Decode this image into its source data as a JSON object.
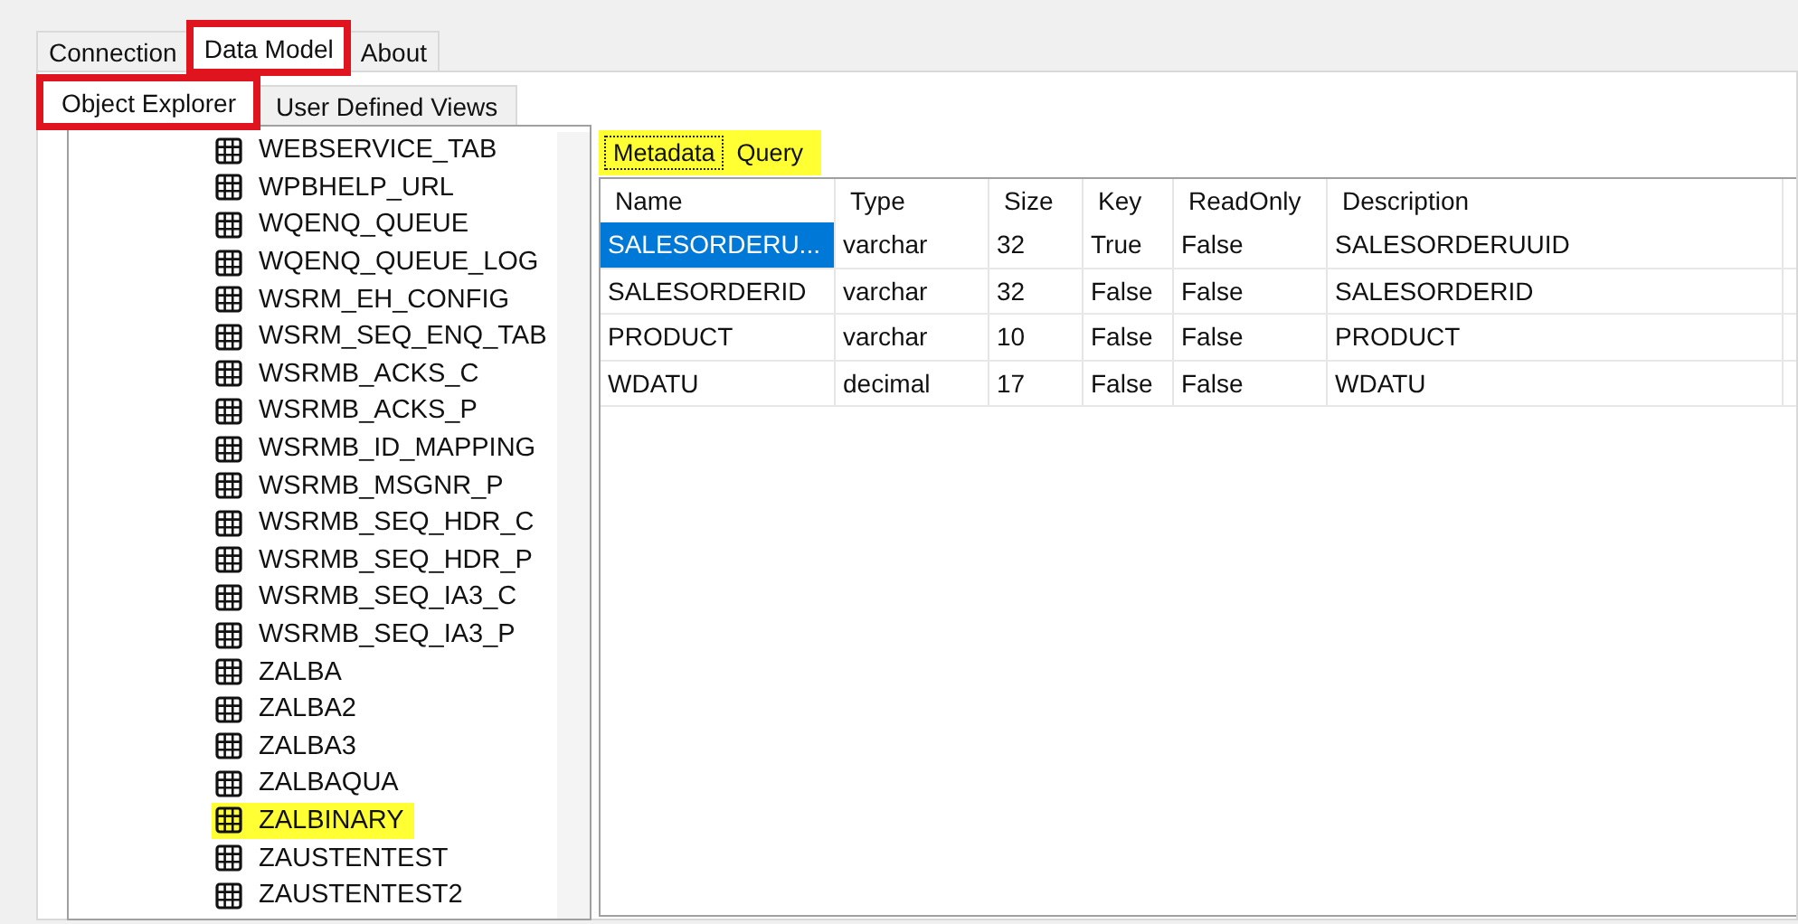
{
  "main_tabs": [
    {
      "label": "Connection",
      "selected": false,
      "marked": false
    },
    {
      "label": "Data Model",
      "selected": true,
      "marked": true
    },
    {
      "label": "About",
      "selected": false,
      "marked": false
    }
  ],
  "sub_tabs": [
    {
      "label": "Object Explorer",
      "selected": true,
      "marked": true
    },
    {
      "label": "User Defined Views",
      "selected": false,
      "marked": false
    }
  ],
  "tree": {
    "items": [
      {
        "label": "WEBSERVICE_TAB",
        "marked": false
      },
      {
        "label": "WPBHELP_URL",
        "marked": false
      },
      {
        "label": "WQENQ_QUEUE",
        "marked": false
      },
      {
        "label": "WQENQ_QUEUE_LOG",
        "marked": false
      },
      {
        "label": "WSRM_EH_CONFIG",
        "marked": false
      },
      {
        "label": "WSRM_SEQ_ENQ_TAB",
        "marked": false
      },
      {
        "label": "WSRMB_ACKS_C",
        "marked": false
      },
      {
        "label": "WSRMB_ACKS_P",
        "marked": false
      },
      {
        "label": "WSRMB_ID_MAPPING",
        "marked": false
      },
      {
        "label": "WSRMB_MSGNR_P",
        "marked": false
      },
      {
        "label": "WSRMB_SEQ_HDR_C",
        "marked": false
      },
      {
        "label": "WSRMB_SEQ_HDR_P",
        "marked": false
      },
      {
        "label": "WSRMB_SEQ_IA3_C",
        "marked": false
      },
      {
        "label": "WSRMB_SEQ_IA3_P",
        "marked": false
      },
      {
        "label": "ZALBA",
        "marked": false
      },
      {
        "label": "ZALBA2",
        "marked": false
      },
      {
        "label": "ZALBA3",
        "marked": false
      },
      {
        "label": "ZALBAQUA",
        "marked": false
      },
      {
        "label": "ZALBINARY",
        "marked": true
      },
      {
        "label": "ZAUSTENTEST",
        "marked": false
      },
      {
        "label": "ZAUSTENTEST2",
        "marked": false
      }
    ]
  },
  "detail_tabs": {
    "marked": true,
    "items": [
      {
        "label": "Metadata",
        "selected": true
      },
      {
        "label": "Query",
        "selected": false
      }
    ]
  },
  "table": {
    "columns": [
      "Name",
      "Type",
      "Size",
      "Key",
      "ReadOnly",
      "Description"
    ],
    "rows": [
      {
        "selected": true,
        "cells": [
          "SALESORDERU...",
          "varchar",
          "32",
          "True",
          "False",
          "SALESORDERUUID"
        ]
      },
      {
        "selected": false,
        "cells": [
          "SALESORDERID",
          "varchar",
          "32",
          "False",
          "False",
          "SALESORDERID"
        ]
      },
      {
        "selected": false,
        "cells": [
          "PRODUCT",
          "varchar",
          "10",
          "False",
          "False",
          "PRODUCT"
        ]
      },
      {
        "selected": false,
        "cells": [
          "WDATU",
          "decimal",
          "17",
          "False",
          "False",
          "WDATU"
        ]
      }
    ]
  }
}
